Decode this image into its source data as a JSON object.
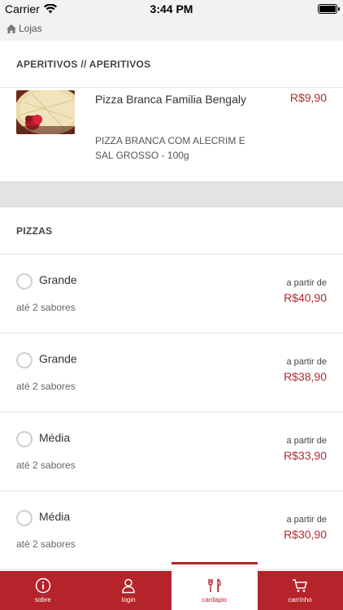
{
  "status_bar": {
    "carrier": "Carrier",
    "time": "3:44 PM"
  },
  "nav": {
    "back_label": "Lojas"
  },
  "sections": {
    "aperitivos": {
      "title": "APERITIVOS // APERITIVOS",
      "product": {
        "name": "Pizza Branca Familia Bengaly",
        "description": "PIZZA BRANCA COM ALECRIM E SAL GROSSO - 100g",
        "price": "R$9,90"
      }
    },
    "pizzas": {
      "title": "PIZZAS",
      "items": [
        {
          "name": "Grande",
          "flavors": "até 2 sabores",
          "from_label": "a partir de",
          "price": "R$40,90"
        },
        {
          "name": "Grande",
          "flavors": "até 2 sabores",
          "from_label": "a partir de",
          "price": "R$38,90"
        },
        {
          "name": "Média",
          "flavors": "até 2 sabores",
          "from_label": "a partir de",
          "price": "R$33,90"
        },
        {
          "name": "Média",
          "flavors": "até 2 sabores",
          "from_label": "a partir de",
          "price": "R$30,90"
        }
      ]
    }
  },
  "tabbar": {
    "tabs": [
      {
        "label": "sobre",
        "icon": "info-icon"
      },
      {
        "label": "login",
        "icon": "user-icon"
      },
      {
        "label": "cardapio",
        "icon": "cutlery-icon"
      },
      {
        "label": "carrinho",
        "icon": "cart-icon"
      }
    ],
    "active_tab": "cardapio"
  },
  "colors": {
    "accent": "#b5232b",
    "price": "#b22a2f",
    "divider_band": "#e3e3e3"
  }
}
